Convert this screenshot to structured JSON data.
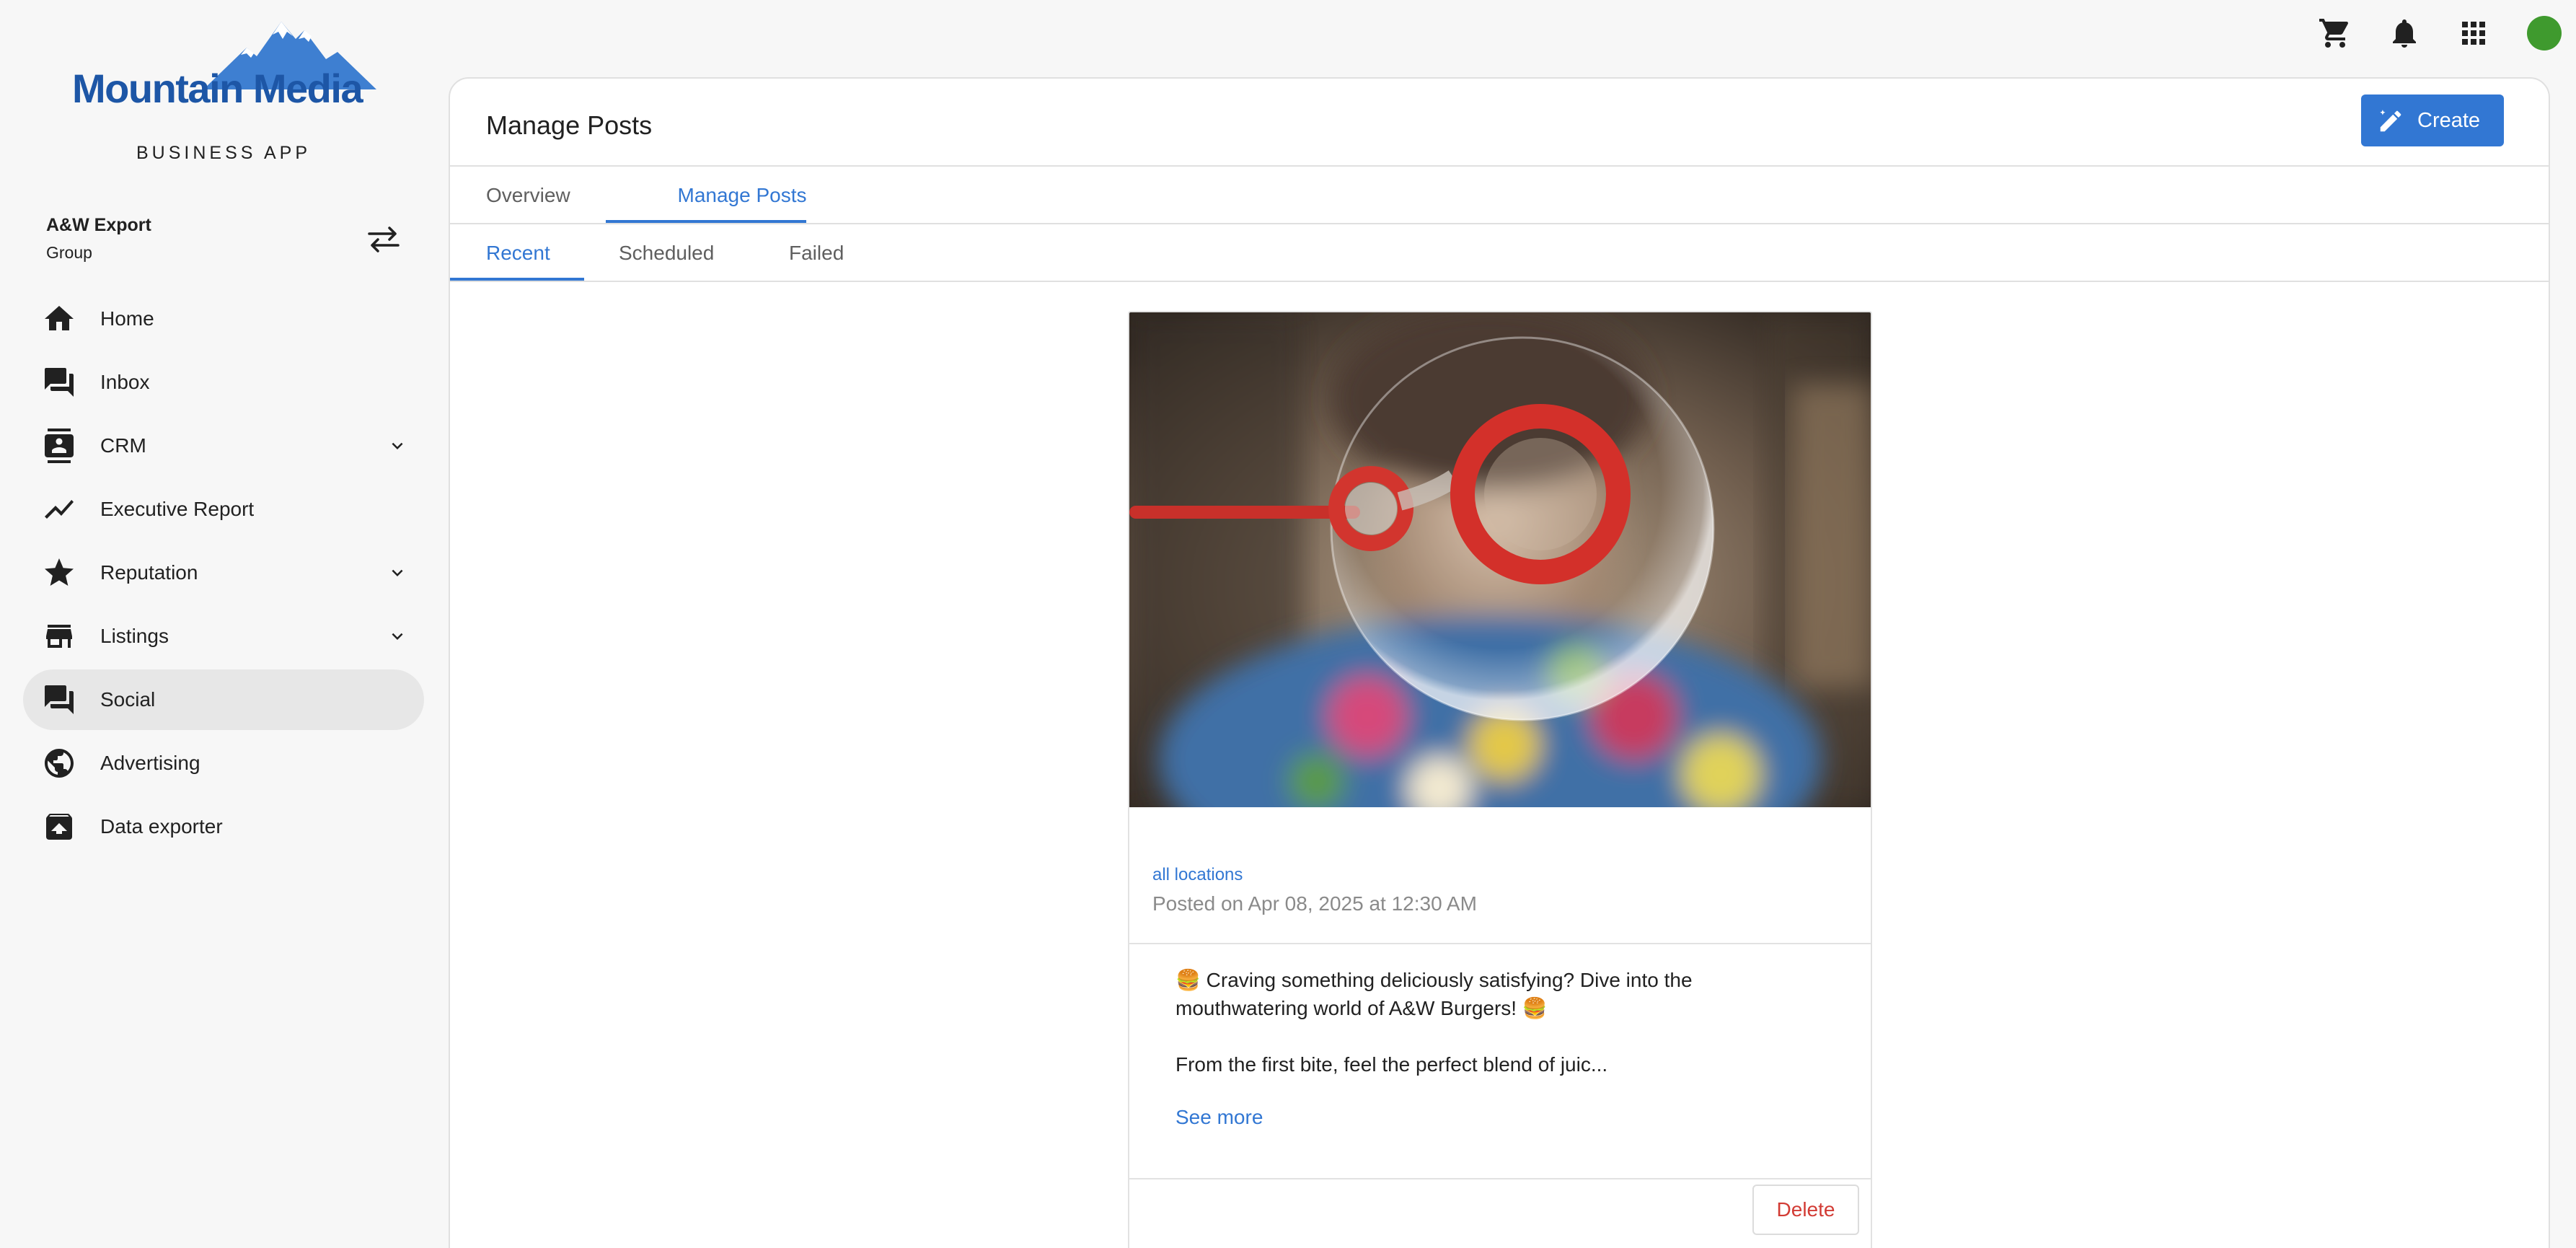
{
  "brand": {
    "logo_text": "Mountain Media",
    "subtitle": "BUSINESS APP",
    "color": "#1d56a6"
  },
  "account": {
    "name": "A&W Export",
    "type": "Group"
  },
  "sidebar": {
    "items": [
      {
        "label": "Home",
        "icon": "home-icon",
        "has_chevron": false,
        "active": false
      },
      {
        "label": "Inbox",
        "icon": "inbox-icon",
        "has_chevron": false,
        "active": false
      },
      {
        "label": "CRM",
        "icon": "contacts-icon",
        "has_chevron": true,
        "active": false
      },
      {
        "label": "Executive Report",
        "icon": "trend-line-icon",
        "has_chevron": false,
        "active": false
      },
      {
        "label": "Reputation",
        "icon": "star-icon",
        "has_chevron": true,
        "active": false
      },
      {
        "label": "Listings",
        "icon": "storefront-icon",
        "has_chevron": true,
        "active": false
      },
      {
        "label": "Social",
        "icon": "forum-icon",
        "has_chevron": false,
        "active": true
      },
      {
        "label": "Advertising",
        "icon": "globe-icon",
        "has_chevron": false,
        "active": false
      },
      {
        "label": "Data exporter",
        "icon": "archive-icon",
        "has_chevron": false,
        "active": false
      }
    ]
  },
  "topbar": {
    "icons": [
      "cart-icon",
      "bell-icon",
      "apps-grid-icon"
    ],
    "avatar_color": "#3f9a2e"
  },
  "main": {
    "title": "Manage Posts",
    "create_label": "Create",
    "tabs": [
      {
        "label": "Overview",
        "active": false
      },
      {
        "label": "Manage Posts",
        "active": true
      }
    ],
    "subtabs": [
      {
        "label": "Recent",
        "active": true
      },
      {
        "label": "Scheduled",
        "active": false
      },
      {
        "label": "Failed",
        "active": false
      }
    ],
    "accent": "#3277d3"
  },
  "post": {
    "locations": "all locations",
    "posted": "Posted on Apr 08, 2025 at 12:30 AM",
    "text_line1": "🍔 Craving something deliciously satisfying? Dive into the mouthwatering world of A&W Burgers! 🍔",
    "text_line2": "From the first bite, feel the perfect blend of juic...",
    "see_more": "See more",
    "delete_label": "Delete"
  }
}
